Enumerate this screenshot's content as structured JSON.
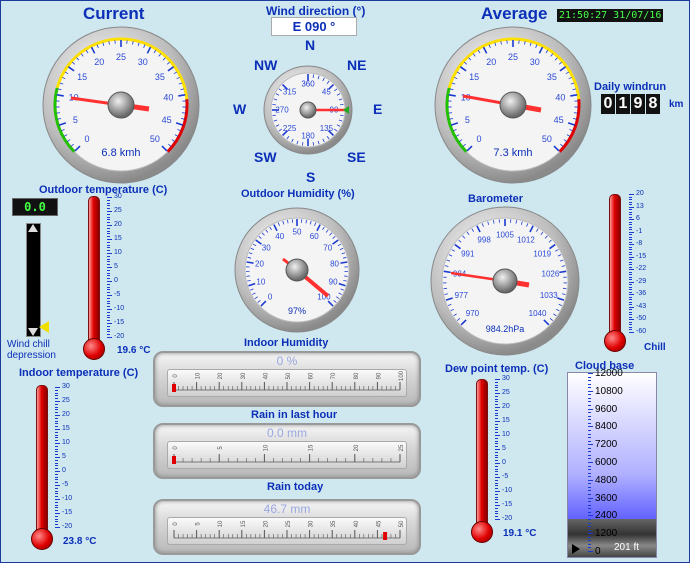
{
  "headers": {
    "current": "Current",
    "average": "Average"
  },
  "timestamp": "21:50:27 31/07/16",
  "wind": {
    "direction_label": "Wind direction (°)",
    "direction_value": "E  090 °",
    "compass": {
      "n": "N",
      "ne": "NE",
      "e": "E",
      "se": "SE",
      "s": "S",
      "sw": "SW",
      "w": "W",
      "nw": "NW"
    },
    "dial_labels": [
      "360",
      "45",
      "90",
      "135",
      "180",
      "225",
      "270",
      "315"
    ],
    "current_speed": "6.8 kmh",
    "average_speed": "7.3 kmh",
    "speed_ticks": [
      "0",
      "5",
      "10",
      "15",
      "20",
      "25",
      "30",
      "35",
      "40",
      "45",
      "50"
    ]
  },
  "daily_windrun": {
    "label": "Daily windrun",
    "digits": [
      "0",
      "1",
      "9",
      "8"
    ],
    "unit": "km"
  },
  "outdoor_temp": {
    "label": "Outdoor temperature (C)",
    "display": "0.0",
    "value": "19.6 °C",
    "scale": [
      "30",
      "25",
      "20",
      "15",
      "10",
      "5",
      "0",
      "-5",
      "-10",
      "-15",
      "-20"
    ],
    "wind_chill_label": "Wind chill depression"
  },
  "humidity": {
    "outdoor_label": "Outdoor Humidity (%)",
    "outdoor_value": "97%",
    "ticks": [
      "0",
      "10",
      "20",
      "30",
      "40",
      "50",
      "60",
      "70",
      "80",
      "90",
      "100"
    ],
    "indoor_label": "Indoor Humidity",
    "indoor_value": "0 %"
  },
  "barometer": {
    "label": "Barometer",
    "value": "984.2hPa",
    "ticks": [
      "970",
      "977",
      "984",
      "991",
      "998",
      "1005",
      "1012",
      "1019",
      "1026",
      "1033",
      "1040"
    ]
  },
  "chill": {
    "label": "Chill",
    "scale": [
      "20",
      "13",
      "6",
      "-1",
      "-8",
      "-15",
      "-22",
      "-29",
      "-36",
      "-43",
      "-50",
      "-60"
    ]
  },
  "indoor_temp": {
    "label": "Indoor temperature (C)",
    "value": "23.8 °C",
    "scale": [
      "30",
      "25",
      "20",
      "15",
      "10",
      "5",
      "0",
      "-5",
      "-10",
      "-15",
      "-20"
    ]
  },
  "rain": {
    "hour_label": "Rain in last hour",
    "hour_value": "0.0 mm",
    "hour_ticks": [
      "0",
      "5",
      "10",
      "15",
      "20",
      "25"
    ],
    "today_label": "Rain today",
    "today_value": "46.7 mm",
    "today_ticks": [
      "0",
      "5",
      "10",
      "15",
      "20",
      "25",
      "30",
      "35",
      "40",
      "45",
      "50"
    ],
    "humidity_ticks": [
      "0",
      "10",
      "20",
      "30",
      "40",
      "50",
      "60",
      "70",
      "80",
      "90",
      "100"
    ]
  },
  "dew_point": {
    "label": "Dew point temp. (C)",
    "value": "19.1 °C",
    "scale": [
      "30",
      "25",
      "20",
      "15",
      "10",
      "5",
      "0",
      "-5",
      "-10",
      "-15",
      "-20"
    ]
  },
  "cloud_base": {
    "label": "Cloud base",
    "value": "201 ft",
    "scale": [
      "12000",
      "10800",
      "9600",
      "8400",
      "7200",
      "6000",
      "4800",
      "3600",
      "2400",
      "1200",
      "0"
    ]
  },
  "colors": {
    "label_blue": "#0b2fb8",
    "mercury": "#e00000",
    "needle": "#ff3030",
    "lcd_green": "#44ff44"
  }
}
